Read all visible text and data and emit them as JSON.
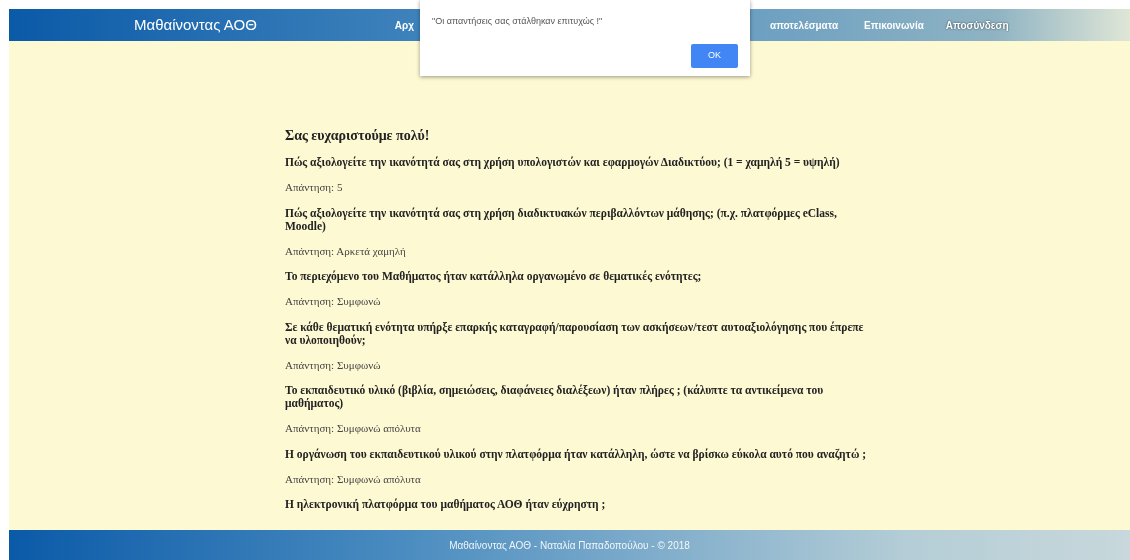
{
  "header": {
    "title": "Μαθαίνοντας ΑΟΘ",
    "nav": [
      "Αρχ",
      "αποτελέσματα",
      "Επικοινωνία",
      "Αποσύνδεση"
    ]
  },
  "dialog": {
    "message": "\"Οι απαντήσεις σας στάλθηκαν επιτυχώς !\"",
    "button": "OK"
  },
  "content": {
    "heading": "Σας ευχαριστούμε πολύ!",
    "items": [
      {
        "question": "Πώς αξιολογείτε την ικανότητά σας στη χρήση υπολογιστών και εφαρμογών Διαδικτύου; (1 = χαμηλή 5 = υψηλή)",
        "answer": "Απάντηση: 5"
      },
      {
        "question": "Πώς αξιολογείτε την ικανότητά σας στη χρήση διαδικτυακών περιβαλλόντων μάθησης; (π.χ. πλατφόρμες eClass, Moodle)",
        "answer": "Απάντηση: Αρκετά χαμηλή"
      },
      {
        "question": "Το περιεχόμενο του Μαθήματος ήταν κατάλληλα οργανωμένο σε θεματικές ενότητες;",
        "answer": "Απάντηση: Συμφωνώ"
      },
      {
        "question": "Σε κάθε θεματική ενότητα υπήρξε επαρκής καταγραφή/παρουσίαση των ασκήσεων/τεστ αυτοαξιολόγησης που έπρεπε να υλοποιηθούν;",
        "answer": "Απάντηση: Συμφωνώ"
      },
      {
        "question": "Το εκπαιδευτικό υλικό (βιβλία, σημειώσεις, διαφάνειες διαλέξεων) ήταν πλήρες ; (κάλυπτε τα αντικείμενα του μαθήματος)",
        "answer": "Απάντηση: Συμφωνώ απόλυτα"
      },
      {
        "question": "Η οργάνωση του εκπαιδευτικού υλικού στην πλατφόρμα ήταν κατάλληλη, ώστε να βρίσκω εύκολα αυτό που αναζητώ ;",
        "answer": "Απάντηση: Συμφωνώ απόλυτα"
      },
      {
        "question": "Η ηλεκτρονική πλατφόρμα του μαθήματος ΑΟΘ ήταν εύχρηστη ;"
      }
    ]
  },
  "footer": "Μαθαίνοντας ΑΟΘ - Ναταλία Παπαδοπούλου - © 2018"
}
